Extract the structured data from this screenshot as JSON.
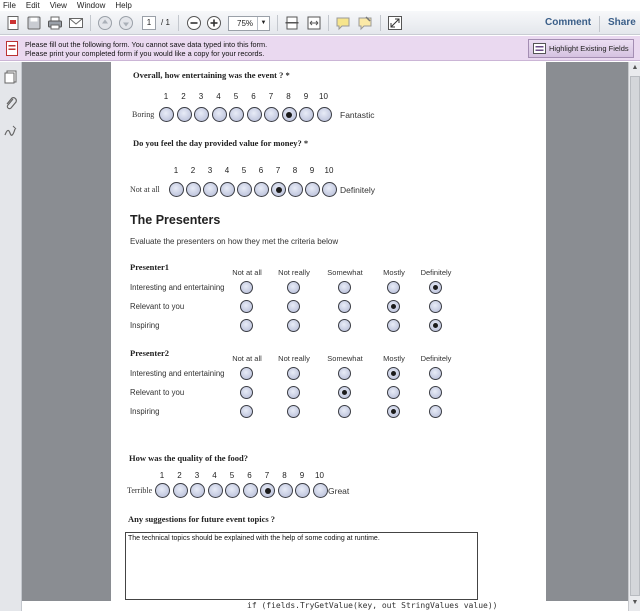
{
  "menu": [
    "File",
    "Edit",
    "View",
    "Window",
    "Help"
  ],
  "toolbar": {
    "page_current": "1",
    "page_total": "/ 1",
    "zoom": "75%",
    "comment_label": "Comment",
    "share_label": "Share"
  },
  "notice": {
    "line1": "Please fill out the following form. You cannot save data typed into this form.",
    "line2": "Please print your completed form if you would like a copy for your records.",
    "highlight_button": "Highlight Existing Fields"
  },
  "form": {
    "q_entertaining": "Overall, how entertaining was the event ? *",
    "scale_10": [
      "1",
      "2",
      "3",
      "4",
      "5",
      "6",
      "7",
      "8",
      "9",
      "10"
    ],
    "boring": "Boring",
    "fantastic": "Fantastic",
    "entertaining_selected": 8,
    "q_value": "Do you feel the day provided value for money? *",
    "not_at_all": "Not at all",
    "definitely": "Definitely",
    "value_selected": 7,
    "presenters_heading": "The Presenters",
    "presenters_sub": "Evaluate the presenters on how they met the criteria below",
    "columns": [
      "Not at all",
      "Not really",
      "Somewhat",
      "Mostly",
      "Definitely"
    ],
    "criteria": [
      "Interesting and entertaining",
      "Relevant to you",
      "Inspiring"
    ],
    "presenter1": {
      "name": "Presenter1",
      "selected": [
        4,
        3,
        4
      ]
    },
    "presenter2": {
      "name": "Presenter2",
      "selected": [
        3,
        2,
        3
      ]
    },
    "q_food": "How was the quality of the food?",
    "terrible": "Terrible",
    "great": "Great",
    "food_selected": 7,
    "q_suggest": "Any suggestions for future event topics ?",
    "suggest_text": "The technical topics should be explained with the help of some coding at runtime."
  },
  "code_strip": "if (fields.TryGetValue(key, out StringValues value))",
  "icons": [
    "save-icon",
    "print-icon",
    "email-icon",
    "prev-page-icon",
    "next-page-icon",
    "zoom-out-icon",
    "zoom-in-icon",
    "fit-page-icon",
    "fit-width-icon",
    "comment-icon",
    "highlight-icon",
    "expand-icon",
    "pages-icon",
    "attachments-icon",
    "signatures-icon",
    "form-doc-icon"
  ],
  "colors": {
    "notice_bg": "#ead9f0",
    "link": "#3a5e88",
    "radio_fill": "#c2c8df"
  }
}
